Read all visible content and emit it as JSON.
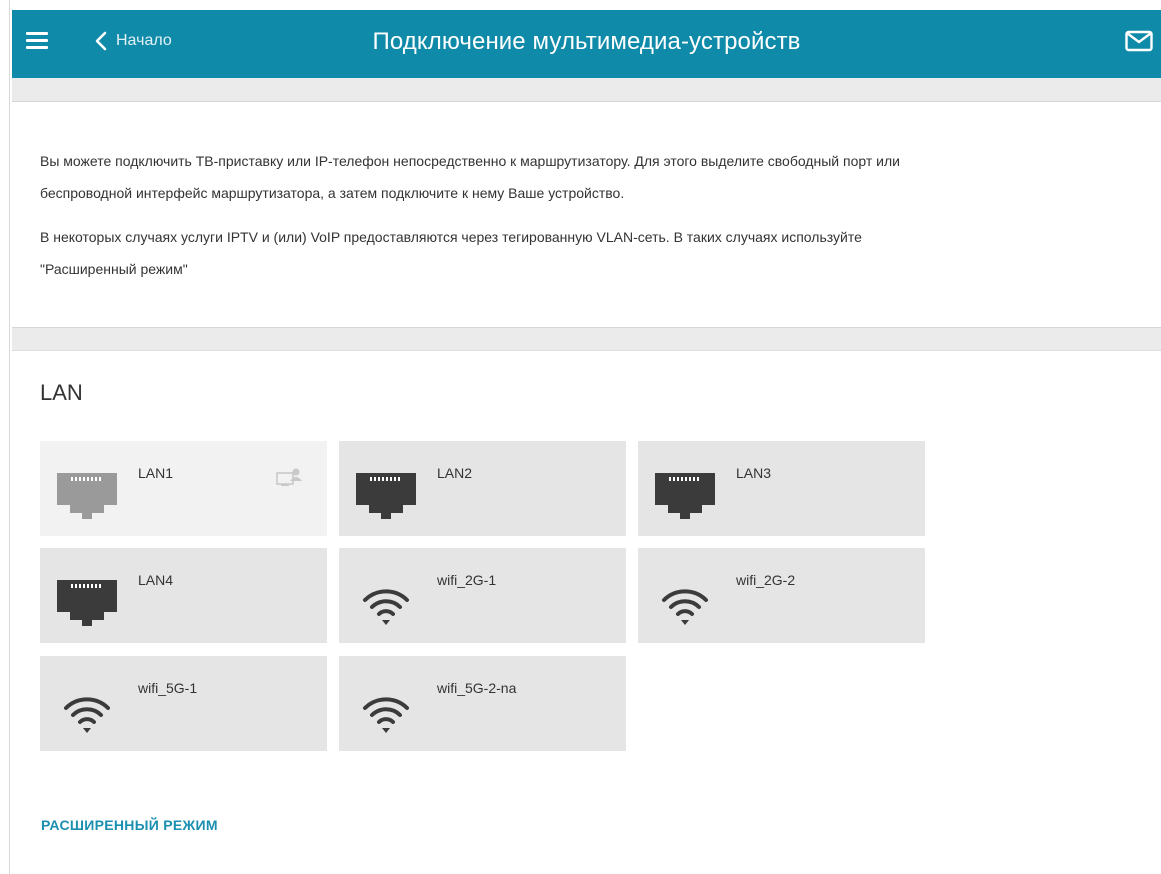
{
  "header": {
    "back_label": "Начало",
    "title": "Подключение мультимедиа-устройств",
    "background_color": "#0f8aa8",
    "icons": [
      "menu-icon",
      "chevron-left-icon",
      "mail-icon"
    ]
  },
  "description": {
    "paragraph1_line1": "Вы можете подключить ТВ-приставку или IP-телефон непосредственно к маршрутизатору. Для этого выделите свободный порт или",
    "paragraph1_line2": "беспроводной интерфейс маршрутизатора, а затем подключите к нему Ваше устройство.",
    "paragraph2_line1": "В некоторых случаях услуги IPTV и (или) VoIP предоставляются через тегированную VLAN-сеть. В таких случаях используйте",
    "paragraph2_line2": "\"Расширенный режим\""
  },
  "lan": {
    "title": "LAN",
    "interfaces": [
      {
        "label": "LAN1",
        "type": "ethernet",
        "state": "assigned",
        "icon": "ethernet-port-icon"
      },
      {
        "label": "LAN2",
        "type": "ethernet",
        "state": "free",
        "icon": "ethernet-port-icon"
      },
      {
        "label": "LAN3",
        "type": "ethernet",
        "state": "free",
        "icon": "ethernet-port-icon"
      },
      {
        "label": "LAN4",
        "type": "ethernet",
        "state": "free",
        "icon": "ethernet-port-icon"
      },
      {
        "label": "wifi_2G-1",
        "type": "wifi",
        "state": "free",
        "icon": "wifi-icon"
      },
      {
        "label": "wifi_2G-2",
        "type": "wifi",
        "state": "free",
        "icon": "wifi-icon"
      },
      {
        "label": "wifi_5G-1",
        "type": "wifi",
        "state": "free",
        "icon": "wifi-icon"
      },
      {
        "label": "wifi_5G-2-na",
        "type": "wifi",
        "state": "free",
        "icon": "wifi-icon"
      }
    ]
  },
  "advanced_mode_label": "РАСШИРЕННЫЙ РЕЖИМ",
  "colors": {
    "accent": "#1a8fb0",
    "tile_background": "#e5e5e5",
    "tile_background_assigned": "#f2f2f2",
    "icon_dark": "#3b3b3b",
    "icon_assigned": "#9a9a9a"
  }
}
